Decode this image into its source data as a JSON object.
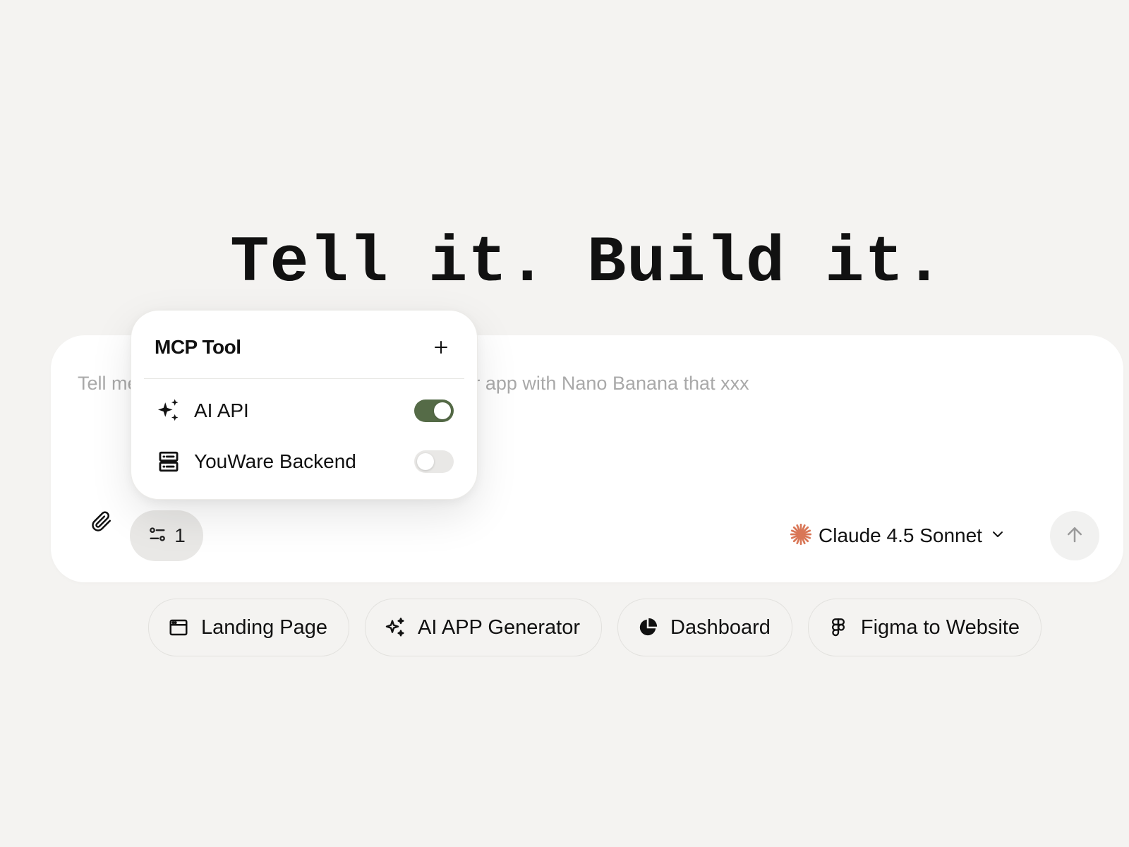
{
  "hero": {
    "title": "Tell it. Build it."
  },
  "composer": {
    "placeholder": "Tell me your idea, e.g. build an image generator app with Nano Banana that xxx",
    "tools_count": "1",
    "model": {
      "label": "Claude 4.5 Sonnet",
      "icon": "claude-asterisk-icon",
      "accent_color": "#d97757"
    }
  },
  "mcp_popup": {
    "title": "MCP Tool",
    "items": [
      {
        "label": "AI API",
        "icon": "sparkles-icon",
        "enabled": true
      },
      {
        "label": "YouWare Backend",
        "icon": "server-icon",
        "enabled": false
      }
    ],
    "toggle_on_color": "#556b47"
  },
  "suggestions": [
    {
      "label": "Landing Page",
      "icon": "browser-window-icon"
    },
    {
      "label": "AI APP Generator",
      "icon": "sparkles-icon"
    },
    {
      "label": "Dashboard",
      "icon": "pie-chart-icon"
    },
    {
      "label": "Figma to Website",
      "icon": "figma-icon"
    }
  ]
}
